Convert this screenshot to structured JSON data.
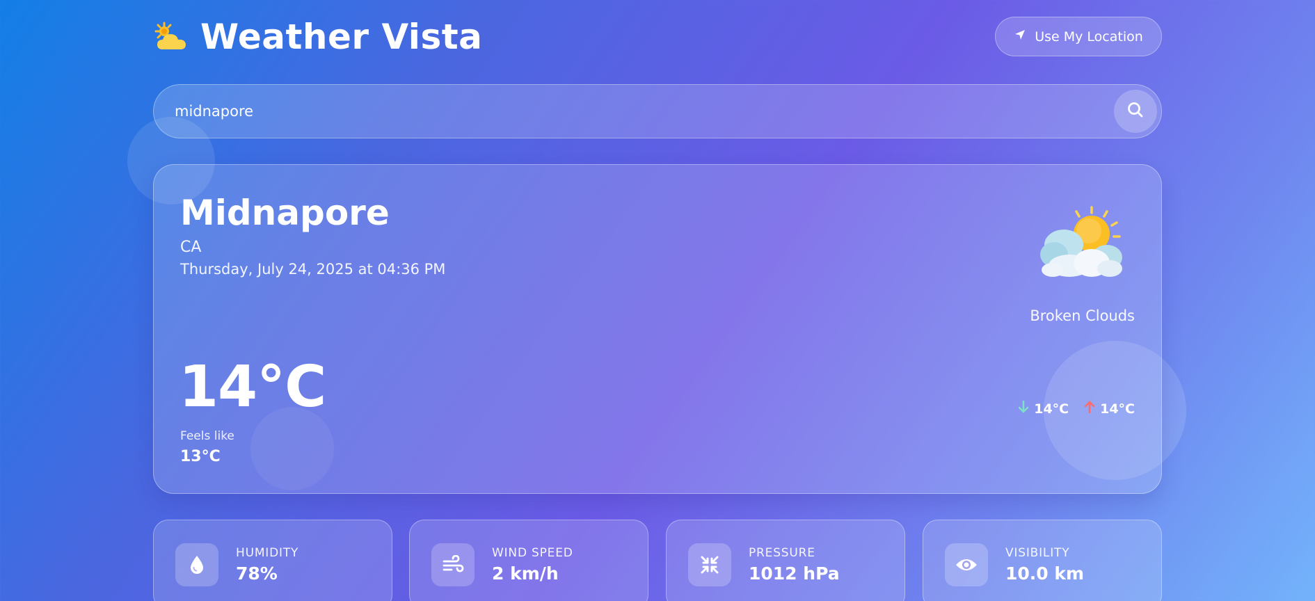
{
  "app": {
    "title": "Weather Vista",
    "logo_icon": "sun-behind-cloud-icon",
    "location_button_label": "Use My Location",
    "location_button_icon": "location-arrow-icon"
  },
  "search": {
    "value": "midnapore",
    "button_icon": "search-icon"
  },
  "current": {
    "city": "Midnapore",
    "region": "CA",
    "datetime": "Thursday, July 24, 2025 at 04:36 PM",
    "temperature": "14°C",
    "feels_like_label": "Feels like",
    "feels_like": "13°C",
    "condition": "Broken Clouds",
    "condition_icon": "sun-behind-clouds-icon",
    "temp_min": "14°C",
    "temp_max": "14°C"
  },
  "stats": [
    {
      "label": "HUMIDITY",
      "value": "78%",
      "icon": "droplet-icon"
    },
    {
      "label": "WIND SPEED",
      "value": "2 km/h",
      "icon": "wind-icon"
    },
    {
      "label": "PRESSURE",
      "value": "1012 hPa",
      "icon": "compress-arrows-icon"
    },
    {
      "label": "VISIBILITY",
      "value": "10.0 km",
      "icon": "eye-icon"
    }
  ],
  "colors": {
    "min_arrow": "#7fe0c8",
    "max_arrow": "#ff6b6b",
    "sun": "#fbbf24",
    "cloud": "#eef3fb"
  }
}
